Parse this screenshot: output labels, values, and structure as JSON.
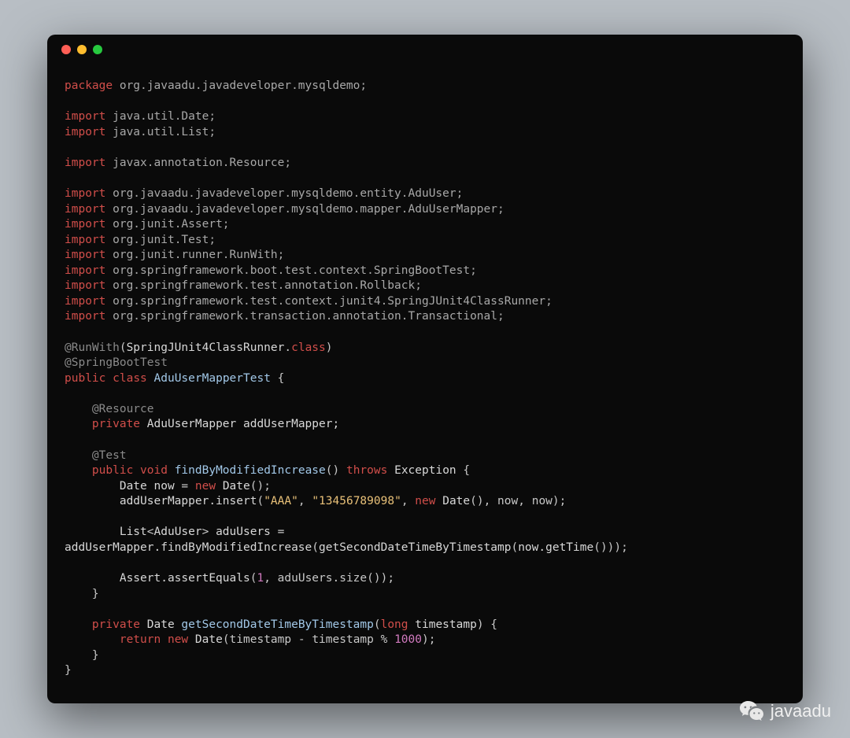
{
  "watermark": {
    "text": "javaadu"
  },
  "code": {
    "tokens": [
      [
        {
          "c": "kw",
          "t": "package"
        },
        {
          "c": "pkg",
          "t": " org.javaadu.javadeveloper.mysqldemo;"
        }
      ],
      [
        {
          "c": "",
          "t": ""
        }
      ],
      [
        {
          "c": "kw",
          "t": "import"
        },
        {
          "c": "pkg",
          "t": " java.util.Date;"
        }
      ],
      [
        {
          "c": "kw",
          "t": "import"
        },
        {
          "c": "pkg",
          "t": " java.util.List;"
        }
      ],
      [
        {
          "c": "",
          "t": ""
        }
      ],
      [
        {
          "c": "kw",
          "t": "import"
        },
        {
          "c": "pkg",
          "t": " javax.annotation.Resource;"
        }
      ],
      [
        {
          "c": "",
          "t": ""
        }
      ],
      [
        {
          "c": "kw",
          "t": "import"
        },
        {
          "c": "pkg",
          "t": " org.javaadu.javadeveloper.mysqldemo.entity.AduUser;"
        }
      ],
      [
        {
          "c": "kw",
          "t": "import"
        },
        {
          "c": "pkg",
          "t": " org.javaadu.javadeveloper.mysqldemo.mapper.AduUserMapper;"
        }
      ],
      [
        {
          "c": "kw",
          "t": "import"
        },
        {
          "c": "pkg",
          "t": " org.junit.Assert;"
        }
      ],
      [
        {
          "c": "kw",
          "t": "import"
        },
        {
          "c": "pkg",
          "t": " org.junit.Test;"
        }
      ],
      [
        {
          "c": "kw",
          "t": "import"
        },
        {
          "c": "pkg",
          "t": " org.junit.runner.RunWith;"
        }
      ],
      [
        {
          "c": "kw",
          "t": "import"
        },
        {
          "c": "pkg",
          "t": " org.springframework.boot.test.context.SpringBootTest;"
        }
      ],
      [
        {
          "c": "kw",
          "t": "import"
        },
        {
          "c": "pkg",
          "t": " org.springframework.test.annotation.Rollback;"
        }
      ],
      [
        {
          "c": "kw",
          "t": "import"
        },
        {
          "c": "pkg",
          "t": " org.springframework.test.context.junit4.SpringJUnit4ClassRunner;"
        }
      ],
      [
        {
          "c": "kw",
          "t": "import"
        },
        {
          "c": "pkg",
          "t": " org.springframework.transaction.annotation.Transactional;"
        }
      ],
      [
        {
          "c": "",
          "t": ""
        }
      ],
      [
        {
          "c": "ann",
          "t": "@RunWith"
        },
        {
          "c": "punc",
          "t": "("
        },
        {
          "c": "type",
          "t": "SpringJUnit4ClassRunner"
        },
        {
          "c": "punc",
          "t": "."
        },
        {
          "c": "kw",
          "t": "class"
        },
        {
          "c": "punc",
          "t": ")"
        }
      ],
      [
        {
          "c": "ann",
          "t": "@SpringBootTest"
        }
      ],
      [
        {
          "c": "kw",
          "t": "public"
        },
        {
          "c": "",
          "t": " "
        },
        {
          "c": "kw",
          "t": "class"
        },
        {
          "c": "",
          "t": " "
        },
        {
          "c": "cls",
          "t": "AduUserMapperTest"
        },
        {
          "c": "punc",
          "t": " {"
        }
      ],
      [
        {
          "c": "",
          "t": ""
        }
      ],
      [
        {
          "c": "",
          "t": "    "
        },
        {
          "c": "ann",
          "t": "@Resource"
        }
      ],
      [
        {
          "c": "",
          "t": "    "
        },
        {
          "c": "kw",
          "t": "private"
        },
        {
          "c": "",
          "t": " "
        },
        {
          "c": "type",
          "t": "AduUserMapper addUserMapper;"
        }
      ],
      [
        {
          "c": "",
          "t": ""
        }
      ],
      [
        {
          "c": "",
          "t": "    "
        },
        {
          "c": "ann",
          "t": "@Test"
        }
      ],
      [
        {
          "c": "",
          "t": "    "
        },
        {
          "c": "kw",
          "t": "public"
        },
        {
          "c": "",
          "t": " "
        },
        {
          "c": "kw",
          "t": "void"
        },
        {
          "c": "",
          "t": " "
        },
        {
          "c": "cls",
          "t": "findByModifiedIncrease"
        },
        {
          "c": "punc",
          "t": "() "
        },
        {
          "c": "kw",
          "t": "throws"
        },
        {
          "c": "",
          "t": " "
        },
        {
          "c": "type",
          "t": "Exception"
        },
        {
          "c": "punc",
          "t": " {"
        }
      ],
      [
        {
          "c": "",
          "t": "        "
        },
        {
          "c": "type",
          "t": "Date now"
        },
        {
          "c": "punc",
          "t": " = "
        },
        {
          "c": "kw",
          "t": "new"
        },
        {
          "c": "",
          "t": " "
        },
        {
          "c": "type",
          "t": "Date"
        },
        {
          "c": "punc",
          "t": "();"
        }
      ],
      [
        {
          "c": "",
          "t": "        "
        },
        {
          "c": "type",
          "t": "addUserMapper.insert"
        },
        {
          "c": "punc",
          "t": "("
        },
        {
          "c": "str",
          "t": "\"AAA\""
        },
        {
          "c": "punc",
          "t": ", "
        },
        {
          "c": "str",
          "t": "\"13456789098\""
        },
        {
          "c": "punc",
          "t": ", "
        },
        {
          "c": "kw",
          "t": "new"
        },
        {
          "c": "",
          "t": " "
        },
        {
          "c": "type",
          "t": "Date"
        },
        {
          "c": "punc",
          "t": "(), now, now);"
        }
      ],
      [
        {
          "c": "",
          "t": ""
        }
      ],
      [
        {
          "c": "",
          "t": "        "
        },
        {
          "c": "type",
          "t": "List"
        },
        {
          "c": "punc",
          "t": "<"
        },
        {
          "c": "type",
          "t": "AduUser"
        },
        {
          "c": "punc",
          "t": "> "
        },
        {
          "c": "type",
          "t": "aduUsers"
        },
        {
          "c": "punc",
          "t": " ="
        }
      ],
      [
        {
          "c": "type",
          "t": "addUserMapper.findByModifiedIncrease"
        },
        {
          "c": "punc",
          "t": "("
        },
        {
          "c": "type",
          "t": "getSecondDateTimeByTimestamp"
        },
        {
          "c": "punc",
          "t": "("
        },
        {
          "c": "type",
          "t": "now.getTime"
        },
        {
          "c": "punc",
          "t": "()));"
        }
      ],
      [
        {
          "c": "",
          "t": ""
        }
      ],
      [
        {
          "c": "",
          "t": "        "
        },
        {
          "c": "type",
          "t": "Assert.assertEquals"
        },
        {
          "c": "punc",
          "t": "("
        },
        {
          "c": "num",
          "t": "1"
        },
        {
          "c": "punc",
          "t": ", aduUsers.size());"
        }
      ],
      [
        {
          "c": "",
          "t": "    "
        },
        {
          "c": "punc",
          "t": "}"
        }
      ],
      [
        {
          "c": "",
          "t": ""
        }
      ],
      [
        {
          "c": "",
          "t": "    "
        },
        {
          "c": "kw",
          "t": "private"
        },
        {
          "c": "",
          "t": " "
        },
        {
          "c": "type",
          "t": "Date "
        },
        {
          "c": "cls",
          "t": "getSecondDateTimeByTimestamp"
        },
        {
          "c": "punc",
          "t": "("
        },
        {
          "c": "kw",
          "t": "long"
        },
        {
          "c": "",
          "t": " "
        },
        {
          "c": "type",
          "t": "timestamp"
        },
        {
          "c": "punc",
          "t": ") {"
        }
      ],
      [
        {
          "c": "",
          "t": "        "
        },
        {
          "c": "kw",
          "t": "return"
        },
        {
          "c": "",
          "t": " "
        },
        {
          "c": "kw",
          "t": "new"
        },
        {
          "c": "",
          "t": " "
        },
        {
          "c": "type",
          "t": "Date"
        },
        {
          "c": "punc",
          "t": "(timestamp - timestamp % "
        },
        {
          "c": "num",
          "t": "1000"
        },
        {
          "c": "punc",
          "t": ");"
        }
      ],
      [
        {
          "c": "",
          "t": "    "
        },
        {
          "c": "punc",
          "t": "}"
        }
      ],
      [
        {
          "c": "punc",
          "t": "}"
        }
      ]
    ]
  }
}
